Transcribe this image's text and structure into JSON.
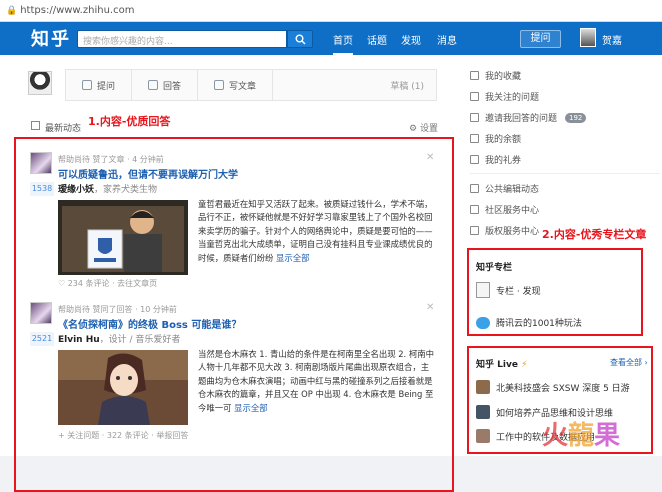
{
  "browser": {
    "url": "https://www.zhihu.com"
  },
  "topbar": {
    "logo": "知乎",
    "search_placeholder": "搜索你感兴趣的内容...",
    "nav": [
      "首页",
      "话题",
      "发现",
      "消息"
    ],
    "ask_label": "提问",
    "user_name": "贺嘉"
  },
  "composer": {
    "buttons": [
      "提问",
      "回答",
      "写文章"
    ],
    "draft_label": "草稿 (1)"
  },
  "feed": {
    "header": "最新动态",
    "settings_label": "设置",
    "annotation": "1.内容-优质回答",
    "cards": [
      {
        "meta": "帮助尚待 赞了文章 · 4 分钟前",
        "title": "可以质疑鲁迅，但请不要再误解万门大学",
        "votes": "1538",
        "author": "瑷缘小妖",
        "bio": "，家养犬类生物",
        "excerpt": "童哲君最近在知乎又活跃了起来。被质疑过钱什么，学术不端，品行不正，被怀疑他就是不好好学习靠家里钱上了个国外名校回来卖学历的骗子。针对个人的网络舆论中，质疑是要可怕的——当童哲克出北大成绩单，证明自己没有挂科且专业课成绩优良的时候，质疑者们纷纷",
        "more": "显示全部",
        "actions": "♡ 234 条评论 · 去往文章页"
      },
      {
        "meta": "帮助尚待 赞同了回答 · 10 分钟前",
        "title": "《名侦探柯南》的终极 Boss 可能是谁？",
        "votes": "2521",
        "author": "Elvin Hu",
        "bio": "，设计 / 音乐爱好者",
        "excerpt": "当然是仓木麻衣 1. 青山给的条件是在柯南里全名出现 2. 柯南中人物十几年都不见大改 3. 柯南剧场版片尾曲出现原衣组合，主题曲均为仓木麻衣演唱；动画中红与黑的碰撞系列之后接着就是仓木麻衣的篇章，并且又在 OP 中出现 4. 仓木麻衣是 Being 至今唯一可",
        "more": "显示全部",
        "actions": "+ 关注问题 · 322 条评论 · 举报回答"
      }
    ]
  },
  "sidebar": {
    "links": [
      {
        "label": "我的收藏"
      },
      {
        "label": "我关注的问题"
      },
      {
        "label": "邀请我回答的问题",
        "count": "192"
      },
      {
        "label": "我的余额"
      },
      {
        "label": "我的礼券"
      }
    ],
    "links2": [
      "公共编辑动态",
      "社区服务中心",
      "版权服务中心"
    ],
    "annotation": "2.内容-优秀专栏文章",
    "column": {
      "title": "知乎专栏",
      "items": [
        "专栏 · 发现",
        "腾讯云的1001种玩法"
      ]
    },
    "live": {
      "title": "知乎 Live",
      "more": "查看全部 ›",
      "items": [
        "北美科技盛会 SXSW 深度 5 日游",
        "如何培养产品思维和设计思维",
        "工作中的软件及数据应用"
      ]
    }
  },
  "watermark": "火龍果"
}
